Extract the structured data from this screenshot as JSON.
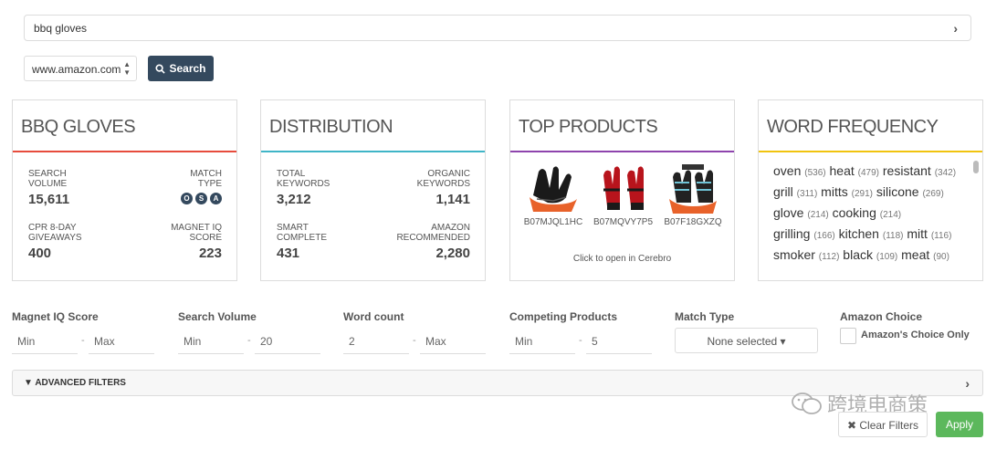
{
  "search": {
    "query": "bbq gloves"
  },
  "marketplace": {
    "selected": "www.amazon.com"
  },
  "search_button": {
    "label": "Search"
  },
  "cards": {
    "keyword": {
      "title": "BBQ GLOVES",
      "accent": "#e74c3c",
      "search_volume_label": "SEARCH VOLUME",
      "search_volume": "15,611",
      "match_type_label": "MATCH TYPE",
      "match_types": [
        "O",
        "S",
        "A"
      ],
      "cpr_label": "CPR 8-DAY GIVEAWAYS",
      "cpr": "400",
      "magnet_label": "MAGNET IQ SCORE",
      "magnet": "223"
    },
    "distribution": {
      "title": "DISTRIBUTION",
      "accent": "#3fb5c7",
      "total_label": "TOTAL KEYWORDS",
      "total": "3,212",
      "organic_label": "ORGANIC KEYWORDS",
      "organic": "1,141",
      "smart_label": "SMART COMPLETE",
      "smart": "431",
      "amazon_label": "AMAZON RECOMMENDED",
      "amazon": "2,280"
    },
    "top_products": {
      "title": "TOP PRODUCTS",
      "accent": "#8e44ad",
      "products": [
        {
          "asin": "B07MJQL1HC"
        },
        {
          "asin": "B07MQVY7P5"
        },
        {
          "asin": "B07F18GXZQ"
        }
      ],
      "footer": "Click to open in Cerebro"
    },
    "word_frequency": {
      "title": "WORD FREQUENCY",
      "accent": "#f1c40f",
      "lines": [
        [
          {
            "w": "oven",
            "c": "(536)"
          },
          {
            "w": "heat",
            "c": "(479)"
          },
          {
            "w": "resistant",
            "c": "(342)"
          }
        ],
        [
          {
            "w": "grill",
            "c": "(311)"
          },
          {
            "w": "mitts",
            "c": "(291)"
          },
          {
            "w": "silicone",
            "c": "(269)"
          }
        ],
        [
          {
            "w": "glove",
            "c": "(214)"
          },
          {
            "w": "cooking",
            "c": "(214)"
          }
        ],
        [
          {
            "w": "grilling",
            "c": "(166)"
          },
          {
            "w": "kitchen",
            "c": "(118)"
          },
          {
            "w": "mitt",
            "c": "(116)"
          }
        ],
        [
          {
            "w": "smoker",
            "c": "(112)"
          },
          {
            "w": "black",
            "c": "(109)"
          },
          {
            "w": "meat",
            "c": "(90)"
          }
        ]
      ]
    }
  },
  "filters": {
    "magnet_iq": {
      "label": "Magnet IQ Score",
      "min": "Min",
      "max": "Max"
    },
    "search_volume": {
      "label": "Search Volume",
      "min": "Min",
      "max": "20"
    },
    "word_count": {
      "label": "Word count",
      "min": "2",
      "max": "Max"
    },
    "competing": {
      "label": "Competing Products",
      "min": "Min",
      "max": "5"
    },
    "match_type": {
      "label": "Match Type",
      "value": "None selected"
    },
    "amazon_choice": {
      "label": "Amazon Choice",
      "option": "Amazon's Choice Only"
    },
    "advanced": "ADVANCED FILTERS",
    "clear": "Clear Filters",
    "apply": "Apply"
  },
  "watermark": "跨境电商策"
}
